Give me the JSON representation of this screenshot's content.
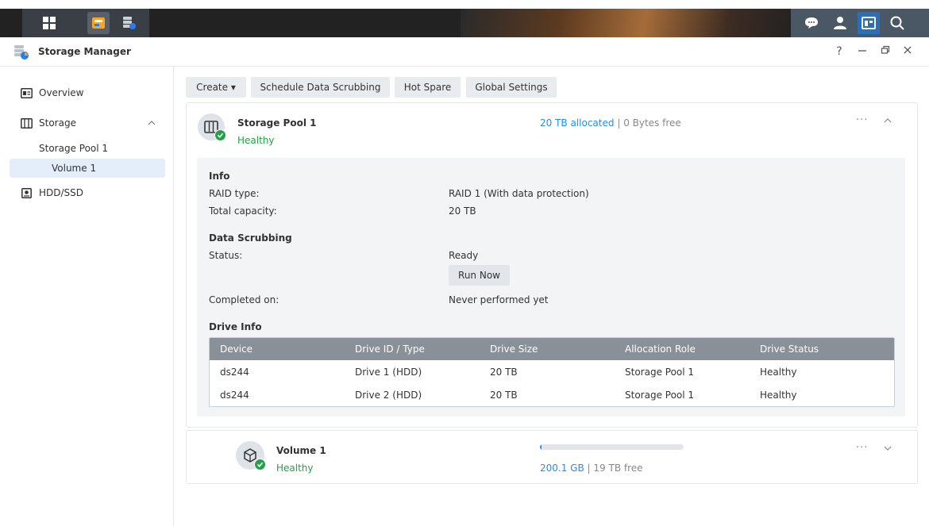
{
  "window": {
    "title": "Storage Manager",
    "help": "?"
  },
  "sidebar": {
    "overview": "Overview",
    "storage": "Storage",
    "storage_pool": "Storage Pool 1",
    "volume": "Volume 1",
    "hdd": "HDD/SSD"
  },
  "toolbar": {
    "create": "Create ▾",
    "scrub": "Schedule Data Scrubbing",
    "hot_spare": "Hot Spare",
    "global": "Global Settings"
  },
  "pool": {
    "name": "Storage Pool 1",
    "status": "Healthy",
    "allocated": "20 TB allocated",
    "separator": "|",
    "free": "0 Bytes free",
    "more": "···",
    "collapse": "^",
    "info_title": "Info",
    "raid_label": "RAID type:",
    "raid_value": "RAID 1 (With data protection)",
    "cap_label": "Total capacity:",
    "cap_value": "20 TB",
    "scrub_title": "Data Scrubbing",
    "status_label": "Status:",
    "status_value": "Ready",
    "run_now": "Run Now",
    "completed_label": "Completed on:",
    "completed_value": "Never performed yet",
    "drive_title": "Drive Info"
  },
  "drive_table": {
    "headers": [
      "Device",
      "Drive ID / Type",
      "Drive Size",
      "Allocation Role",
      "Drive Status"
    ],
    "rows": [
      [
        "ds244",
        "Drive 1 (HDD)",
        "20 TB",
        "Storage Pool 1",
        "Healthy"
      ],
      [
        "ds244",
        "Drive 2 (HDD)",
        "20 TB",
        "Storage Pool 1",
        "Healthy"
      ]
    ]
  },
  "volume": {
    "name": "Volume 1",
    "status": "Healthy",
    "used": "200.1 GB",
    "separator": "|",
    "free": "19 TB free",
    "usage_fraction": 0.01,
    "more": "···"
  },
  "colors": {
    "accent": "#1f8ff5",
    "healthy": "#24a148",
    "header_gray": "#8a9097"
  }
}
